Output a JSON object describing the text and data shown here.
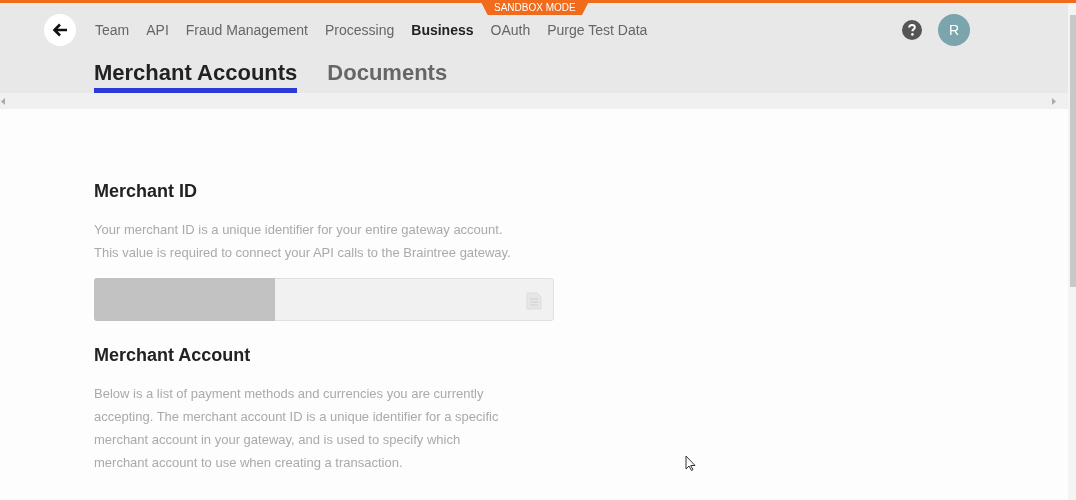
{
  "banner": "SANDBOX MODE",
  "nav": [
    {
      "label": "Team",
      "selected": false
    },
    {
      "label": "API",
      "selected": false
    },
    {
      "label": "Fraud Management",
      "selected": false
    },
    {
      "label": "Processing",
      "selected": false
    },
    {
      "label": "Business",
      "selected": true
    },
    {
      "label": "OAuth",
      "selected": false
    },
    {
      "label": "Purge Test Data",
      "selected": false
    }
  ],
  "avatar": "R",
  "tabs": [
    {
      "label": "Merchant Accounts",
      "selected": true
    },
    {
      "label": "Documents",
      "selected": false
    }
  ],
  "sections": [
    {
      "kind": "field",
      "heading": "Merchant ID",
      "lines": [
        "Your merchant ID is a unique identifier for your entire gateway account.",
        "This value is required to connect your API calls to the Braintree gateway."
      ]
    },
    {
      "kind": "text",
      "heading": "Merchant Account",
      "lines": [
        "Below is a list of payment methods and currencies you are currently",
        "accepting. The merchant account ID is a unique identifier for a specific",
        "merchant account in your gateway, and is used to specify which",
        "merchant account to use when creating a transaction."
      ]
    }
  ]
}
